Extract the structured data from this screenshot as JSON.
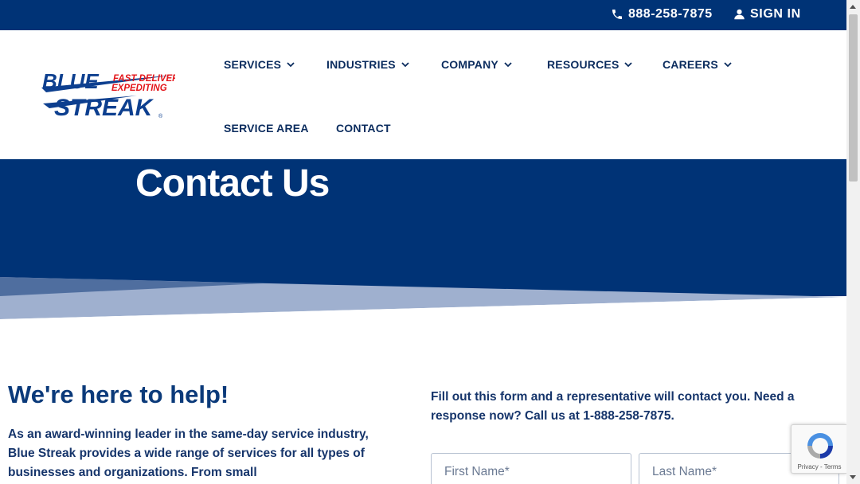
{
  "topbar": {
    "phone": "888-258-7875",
    "signin": "SIGN IN"
  },
  "logo": {
    "word1": "BLUE",
    "word2": "STREAK",
    "tag1": "FAST DELIVERY",
    "tag2": "EXPEDITING",
    "registered": "®"
  },
  "nav": {
    "services": "SERVICES",
    "industries": "INDUSTRIES",
    "company": "COMPANY",
    "resources": "RESOURCES",
    "careers": "CAREERS",
    "service_area": "SERVICE AREA",
    "contact": "CONTACT"
  },
  "hero": {
    "title": "Contact Us"
  },
  "content": {
    "heading": "We're here to help!",
    "intro": "As an award-winning leader in the same-day service industry, Blue Streak provides a wide range of services for all types of businesses and organizations. From small",
    "form_intro": "Fill out this form and a representative will contact you. Need a response now? Call us at 1-888-258-7875."
  },
  "form": {
    "first_name_placeholder": "First Name*",
    "last_name_placeholder": "Last Name*"
  },
  "recaptcha": {
    "links": "Privacy - Terms"
  },
  "colors": {
    "brand_navy": "#003376",
    "logo_blue": "#0d3f8f",
    "logo_red": "#e3151a",
    "wave_light": "#9fb0cf",
    "wave_mid": "#4f6e9f"
  }
}
